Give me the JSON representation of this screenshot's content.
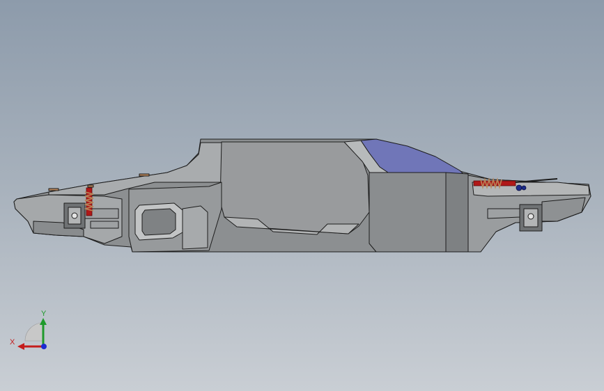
{
  "viewport": {
    "background_top": "#8d9bab",
    "background_bottom": "#c9ced4"
  },
  "model": {
    "body_color": "#8c8f91",
    "edge_color": "#1c1c1c",
    "window_color": "#7076b8",
    "spring_color": "#b8865a",
    "damper_color": "#b01818"
  },
  "triad": {
    "x_label": "X",
    "y_label": "Y",
    "x_color": "#c41c1c",
    "y_color": "#1f9a2c",
    "z_color": "#1c2bd1"
  }
}
